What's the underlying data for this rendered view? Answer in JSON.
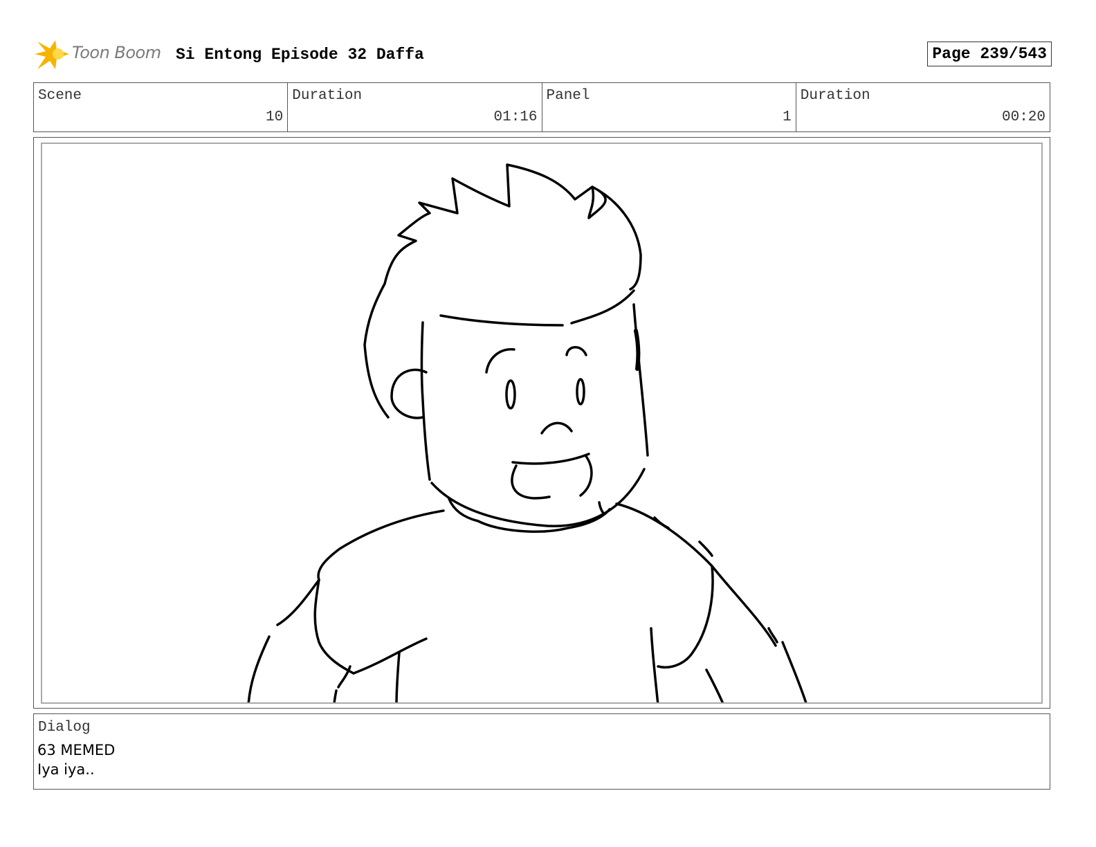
{
  "header": {
    "logo_text": "Toon Boom",
    "title": "Si Entong Episode 32 Daffa",
    "page": "Page 239/543"
  },
  "info": {
    "scene_label": "Scene",
    "scene_value": "10",
    "scene_duration_label": "Duration",
    "scene_duration_value": "01:16",
    "panel_label": "Panel",
    "panel_value": "1",
    "panel_duration_label": "Duration",
    "panel_duration_value": "00:20"
  },
  "dialog": {
    "label": "Dialog",
    "line1": "63 MEMED",
    "line2": "Iya iya.."
  },
  "colors": {
    "logo_accent": "#f6b400",
    "border": "#555555",
    "panel_border": "#aaaaaa"
  }
}
